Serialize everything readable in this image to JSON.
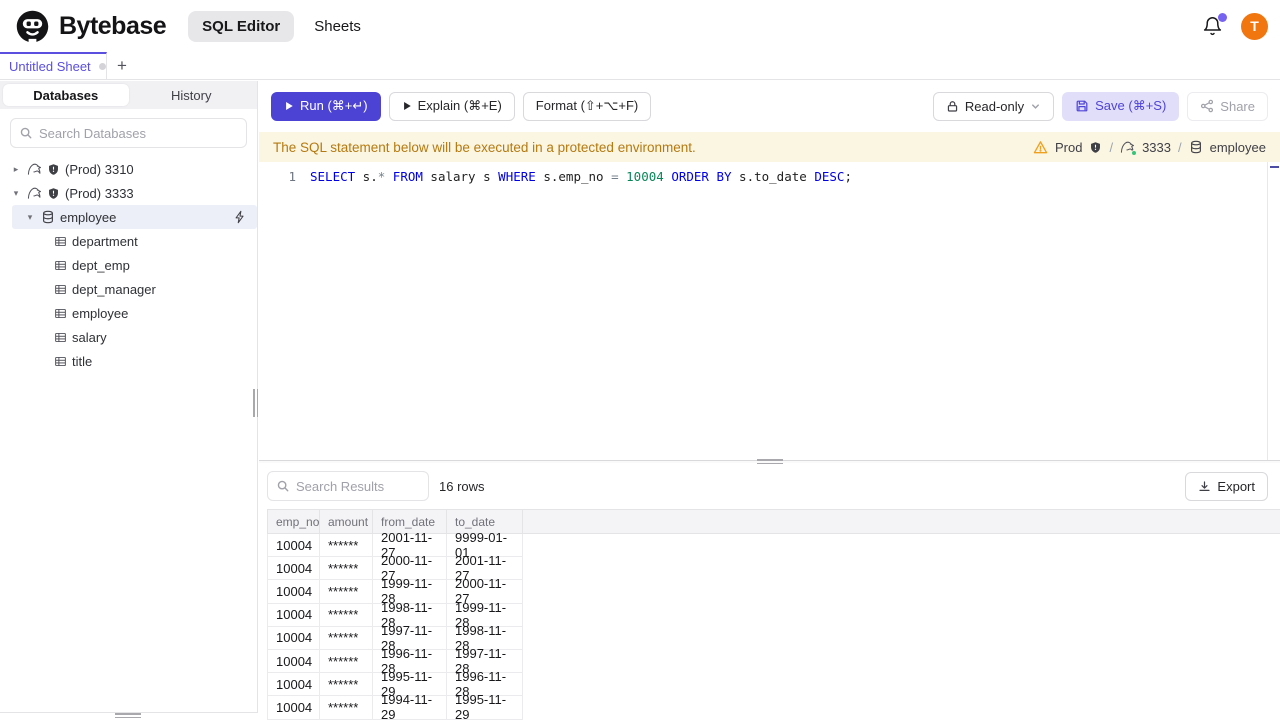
{
  "header": {
    "brand": "Bytebase",
    "nav_sql_editor": "SQL Editor",
    "nav_sheets": "Sheets",
    "avatar_letter": "T"
  },
  "tabs": {
    "active_tab": "Untitled Sheet",
    "new_tab_label": "+"
  },
  "sidebar": {
    "tabs": [
      "Databases",
      "History"
    ],
    "search_placeholder": "Search Databases",
    "tree": {
      "instances": [
        {
          "label": "(Prod) 3310",
          "expanded": false,
          "icons": [
            "mysql-icon",
            "shield-icon"
          ]
        },
        {
          "label": "(Prod) 3333",
          "expanded": true,
          "icons": [
            "mysql-icon",
            "shield-icon"
          ]
        }
      ],
      "database": {
        "label": "employee",
        "selected": true,
        "icon": "database-icon",
        "action_icon": "connect-lightning-icon"
      },
      "tables": [
        "department",
        "dept_emp",
        "dept_manager",
        "employee",
        "salary",
        "title"
      ]
    }
  },
  "toolbar": {
    "run_label": "Run (⌘+↵)",
    "explain_label": "Explain (⌘+E)",
    "format_label": "Format (⇧+⌥+F)",
    "readonly_label": "Read-only",
    "save_label": "Save (⌘+S)",
    "share_label": "Share"
  },
  "banner": {
    "message": "The SQL statement below will be executed in a protected environment.",
    "environment": "Prod",
    "instance": "3333",
    "database": "employee",
    "separator": "/"
  },
  "editor": {
    "line_number": "1",
    "sql_tokens": [
      {
        "text": "SELECT",
        "type": "keyword"
      },
      {
        "text": " s.",
        "type": "plain"
      },
      {
        "text": "*",
        "type": "operator"
      },
      {
        "text": " ",
        "type": "plain"
      },
      {
        "text": "FROM",
        "type": "keyword"
      },
      {
        "text": " salary s ",
        "type": "plain"
      },
      {
        "text": "WHERE",
        "type": "keyword"
      },
      {
        "text": " s.emp_no ",
        "type": "plain"
      },
      {
        "text": "=",
        "type": "operator"
      },
      {
        "text": " ",
        "type": "plain"
      },
      {
        "text": "10004",
        "type": "number"
      },
      {
        "text": " ",
        "type": "plain"
      },
      {
        "text": "ORDER BY",
        "type": "keyword"
      },
      {
        "text": " s.to_date ",
        "type": "plain"
      },
      {
        "text": "DESC",
        "type": "keyword"
      },
      {
        "text": ";",
        "type": "plain"
      }
    ]
  },
  "results": {
    "search_placeholder": "Search Results",
    "row_count": "16 rows",
    "export_label": "Export",
    "table": {
      "columns": [
        "emp_no",
        "amount",
        "from_date",
        "to_date"
      ],
      "rows": [
        [
          "10004",
          "******",
          "2001-11-27",
          "9999-01-01"
        ],
        [
          "10004",
          "******",
          "2000-11-27",
          "2001-11-27"
        ],
        [
          "10004",
          "******",
          "1999-11-28",
          "2000-11-27"
        ],
        [
          "10004",
          "******",
          "1998-11-28",
          "1999-11-28"
        ],
        [
          "10004",
          "******",
          "1997-11-28",
          "1998-11-28"
        ],
        [
          "10004",
          "******",
          "1996-11-28",
          "1997-11-28"
        ],
        [
          "10004",
          "******",
          "1995-11-29",
          "1996-11-28"
        ],
        [
          "10004",
          "******",
          "1994-11-29",
          "1995-11-29"
        ]
      ]
    }
  },
  "colors": {
    "accent": "#4c42d4",
    "accent_text": "#5b4fe0",
    "save_bg": "#e1defa",
    "avatar": "#f2760f",
    "banner_bg": "#fbf6e2",
    "banner_text": "#b5790f",
    "warning": "#f0a020",
    "status_green": "#35c57a",
    "notification_dot": "#7763f1",
    "sql_keyword": "#0000e6",
    "sql_number": "#098658",
    "sql_operator": "#74808c"
  }
}
